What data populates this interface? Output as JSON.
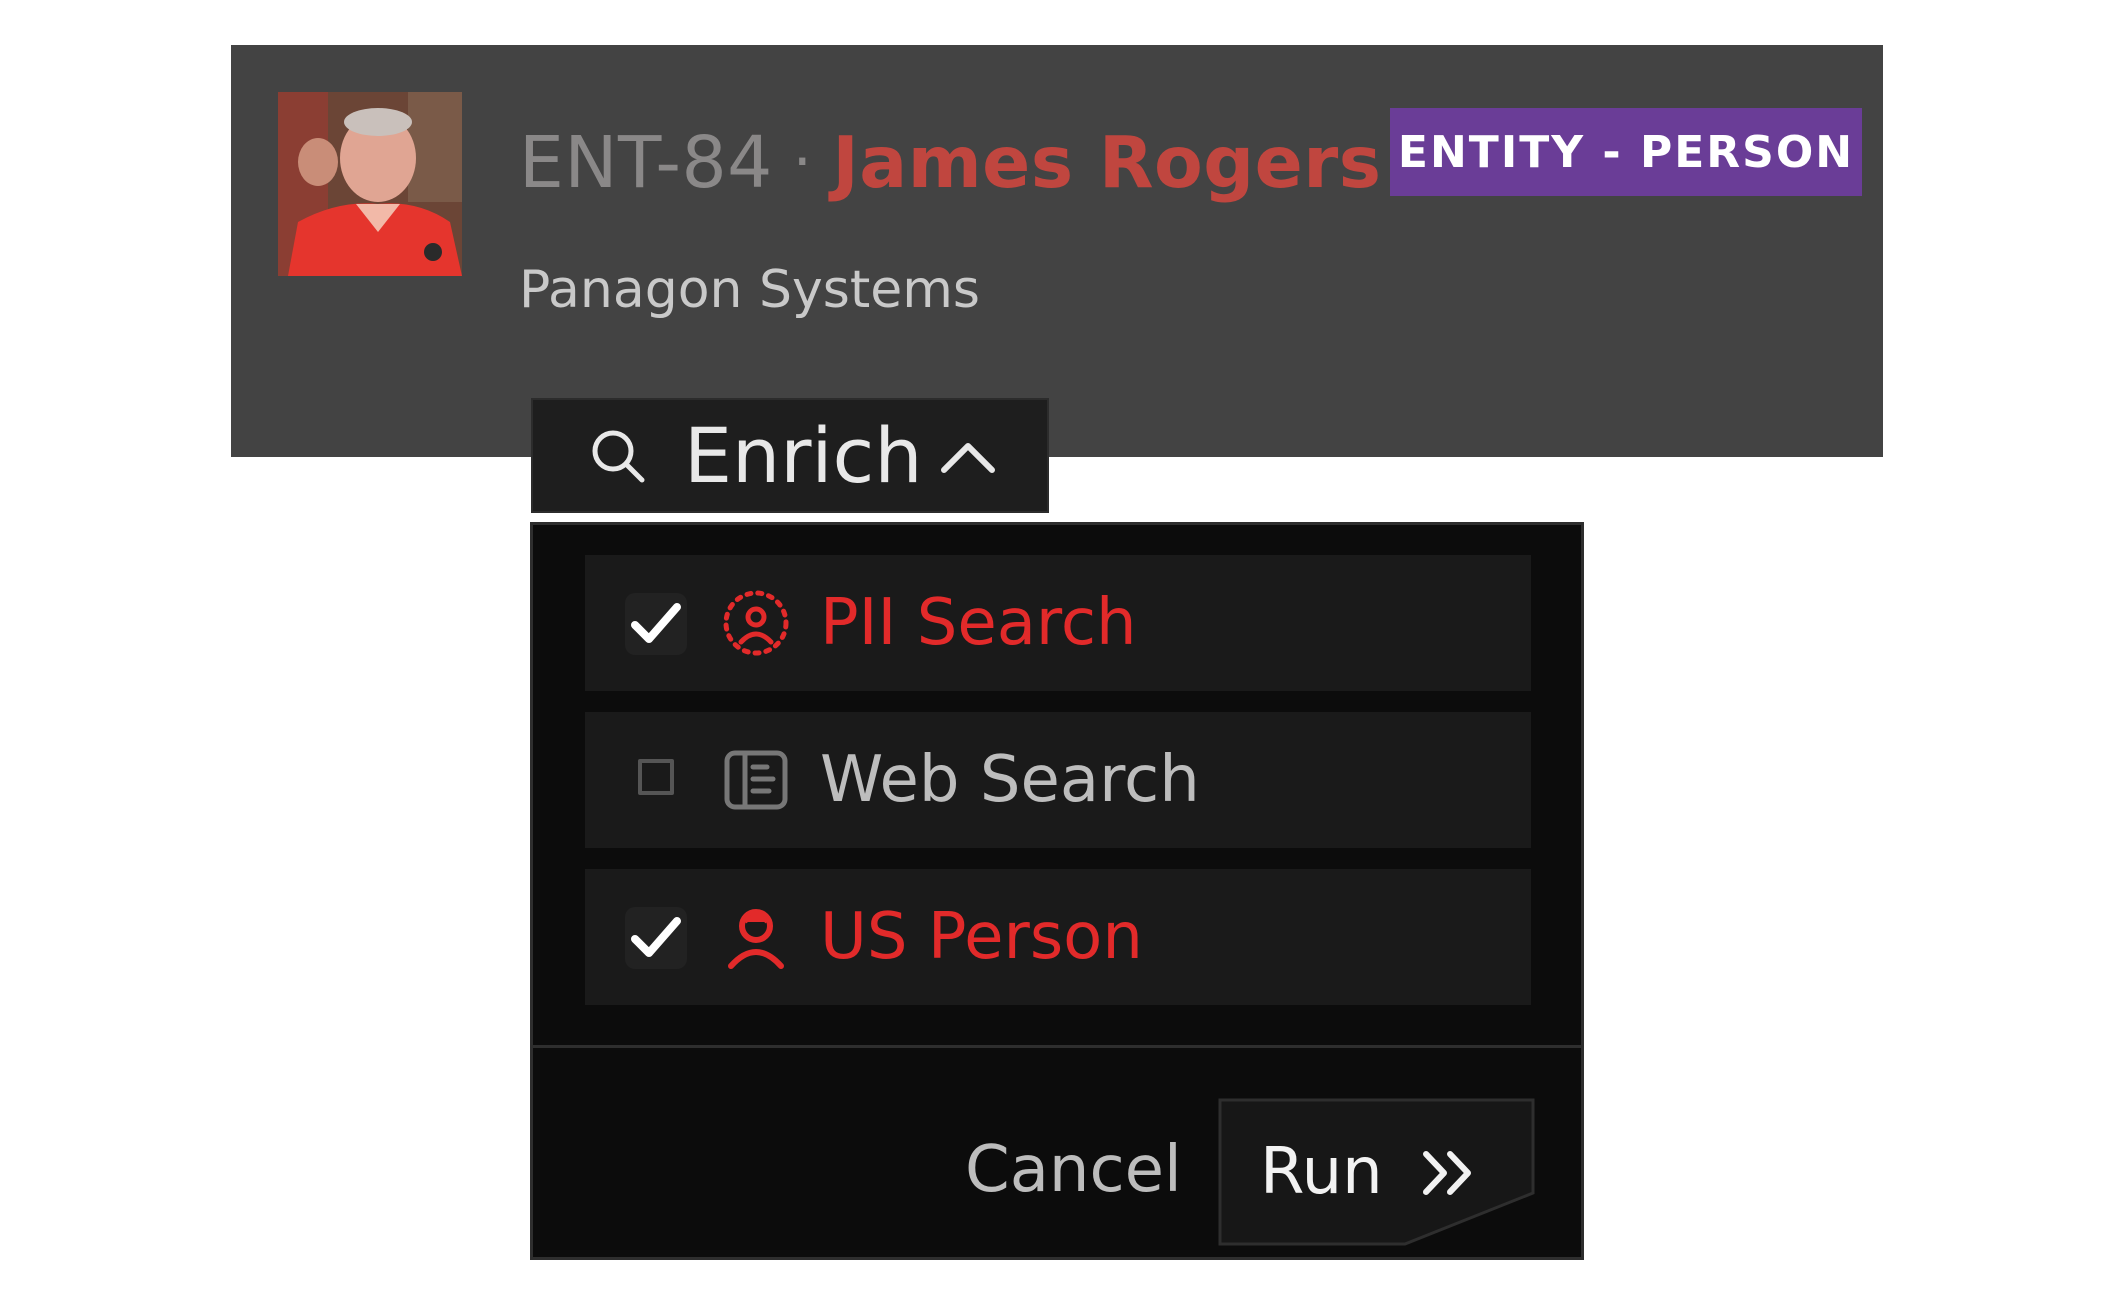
{
  "header": {
    "entity_id": "ENT-84",
    "separator": "·",
    "entity_name": "James Rogers",
    "type_badge": "ENTITY - PERSON",
    "organization": "Panagon Systems",
    "avatar": "person-photo"
  },
  "enrich": {
    "label": "Enrich",
    "icon": "search-icon",
    "state_icon": "chevron-up-icon",
    "expanded": true
  },
  "options": [
    {
      "label": "PII Search",
      "icon": "pii-person-icon",
      "checked": true
    },
    {
      "label": "Web Search",
      "icon": "web-layout-icon",
      "checked": false
    },
    {
      "label": "US Person",
      "icon": "user-icon",
      "checked": true
    }
  ],
  "actions": {
    "cancel_label": "Cancel",
    "run_label": "Run",
    "run_icon": "double-chevron-right-icon"
  },
  "colors": {
    "header_bg": "#434343",
    "badge_bg": "#6a3d97",
    "accent_red": "#e22a2a",
    "name_red": "#c0463f",
    "panel_bg": "#0c0c0c",
    "option_bg": "#1a1a1a"
  }
}
